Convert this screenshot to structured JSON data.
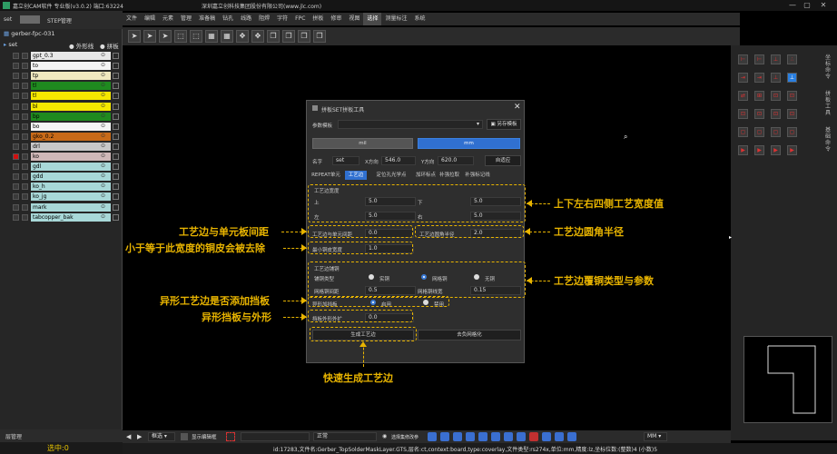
{
  "window": {
    "title": "嘉立创CAM软件 专业版(v3.0.2) 端口:63224",
    "company": "深圳嘉立创科技集团股份有限公司(www.jlc.com)",
    "buttons": [
      "—",
      "▢",
      "✕"
    ]
  },
  "menu": [
    "文件",
    "编辑",
    "元素",
    "管理",
    "准备稿",
    "钻孔",
    "线路",
    "阻焊",
    "字符",
    "FPC",
    "拼板",
    "修审",
    "视图",
    "选择",
    "测量标注",
    "系统"
  ],
  "menu_active": "选择",
  "toolbar_icons": [
    "arrow-select-icon",
    "arrow-select-icon",
    "arrow-select-icon",
    "box-select-icon",
    "box-select-icon",
    "grid-select-icon",
    "grid-select-icon",
    "move-icon",
    "move-icon",
    "copy-icon",
    "copy-icon",
    "copy-icon",
    "copy-icon"
  ],
  "left_panel": {
    "tab1": "set",
    "tab2": "STEP管理",
    "job": "gerber-fpc-031",
    "step": "set",
    "col_outline": "外形线",
    "col_panel": "拼板",
    "layers": [
      {
        "name": "gpt_0.3",
        "color": "#e8e8e8"
      },
      {
        "name": "to",
        "color": "#f5f5f5"
      },
      {
        "name": "tp",
        "color": "#f0e8c0"
      },
      {
        "name": "tl",
        "color": "#1f8a1f"
      },
      {
        "name": "tl",
        "color": "#f5e800"
      },
      {
        "name": "bl",
        "color": "#f5e800"
      },
      {
        "name": "bp",
        "color": "#1f8a1f"
      },
      {
        "name": "bo",
        "color": "#f5f5f5"
      },
      {
        "name": "gko_0.2",
        "color": "#c86a18"
      },
      {
        "name": "drl",
        "color": "#c8c8c8"
      },
      {
        "name": "ko",
        "color": "#d0b8b8"
      },
      {
        "name": "gdl",
        "color": "#a8d8d8"
      },
      {
        "name": "gdd",
        "color": "#a8d8d8"
      },
      {
        "name": "ko_h",
        "color": "#a8d8d8"
      },
      {
        "name": "ko_jg",
        "color": "#a8d8d8"
      },
      {
        "name": "mark",
        "color": "#a8d8d8"
      },
      {
        "name": "tabcopper_bak",
        "color": "#a8d8d8"
      }
    ],
    "footer": "层管理",
    "selected_label": "选中:0"
  },
  "dialog": {
    "title": "拼板SET拼板工具",
    "template_label": "参数模板",
    "save_template": "另存模板",
    "unit_mil": "mil",
    "unit_mm": "mm",
    "name_label": "名字",
    "name_value": "set",
    "x_label": "X方向",
    "x_value": "546.0",
    "y_label": "Y方向",
    "y_value": "620.0",
    "auto_fit": "自适应",
    "tabs": [
      "REPEAT单元",
      "工艺边",
      "定位孔光学点",
      "加环标点",
      "补强拉取",
      "补强标记线"
    ],
    "active_tab": "工艺边",
    "width_group": "工艺边宽度",
    "top_label": "上",
    "top_value": "5.0",
    "bottom_label": "下",
    "bottom_value": "5.0",
    "left_label": "左",
    "left_value": "5.0",
    "right_label": "右",
    "right_value": "5.0",
    "spacing_label": "工艺边与单元间距",
    "spacing_value": "0.0",
    "corner_label": "工艺边圆角半径",
    "corner_value": "2.0",
    "minw_label": "最小铜皮宽度",
    "minw_value": "1.0",
    "copper_group": "工艺边铺铜",
    "copper_type_label": "铺铜类型",
    "copper_types": [
      "实铜",
      "网格铜",
      "无铜"
    ],
    "copper_selected": "网格铜",
    "grid_spacing_label": "网格铜间距",
    "grid_spacing_value": "0.5",
    "grid_width_label": "网格铜线宽",
    "grid_width_value": "0.15",
    "irregular_label": "异形加挡板",
    "irregular_options": [
      "启用",
      "禁用"
    ],
    "irregular_selected": "启用",
    "offset_label": "挡板外形外扩",
    "offset_value": "0.0",
    "generate": "生成工艺边",
    "remove_grid": "去负网格化"
  },
  "annotations": {
    "width": "上下左右四侧工艺宽度值",
    "spacing": "工艺边与单元板间距",
    "corner": "工艺边圆角半径",
    "minw": "小于等于此宽度的铜皮会被去除",
    "copper": "工艺边覆铜类型与参数",
    "irregular": "异形工艺边是否添加挡板",
    "offset": "异形挡板与外形",
    "generate": "快速生成工艺边"
  },
  "right_panel": {
    "labels": [
      "坐标命令",
      "拼板工具",
      "基础命令"
    ]
  },
  "bottom_bar": {
    "mode": "框选",
    "view_label": "显示编辑框",
    "input_mode": "正常",
    "pick_label": "选择集修改参",
    "unit": "MM"
  },
  "status": "id:17283,文件名:Gerber_TopSolderMaskLayer.GTS,层名:ct,context:board,type:coverlay,文件类型:rs274x,单位:mm,精度:lz,坐标位数:(整数)4 (小数)5",
  "colors": {
    "accent": "#3070d0",
    "annotation": "#e8b400"
  }
}
